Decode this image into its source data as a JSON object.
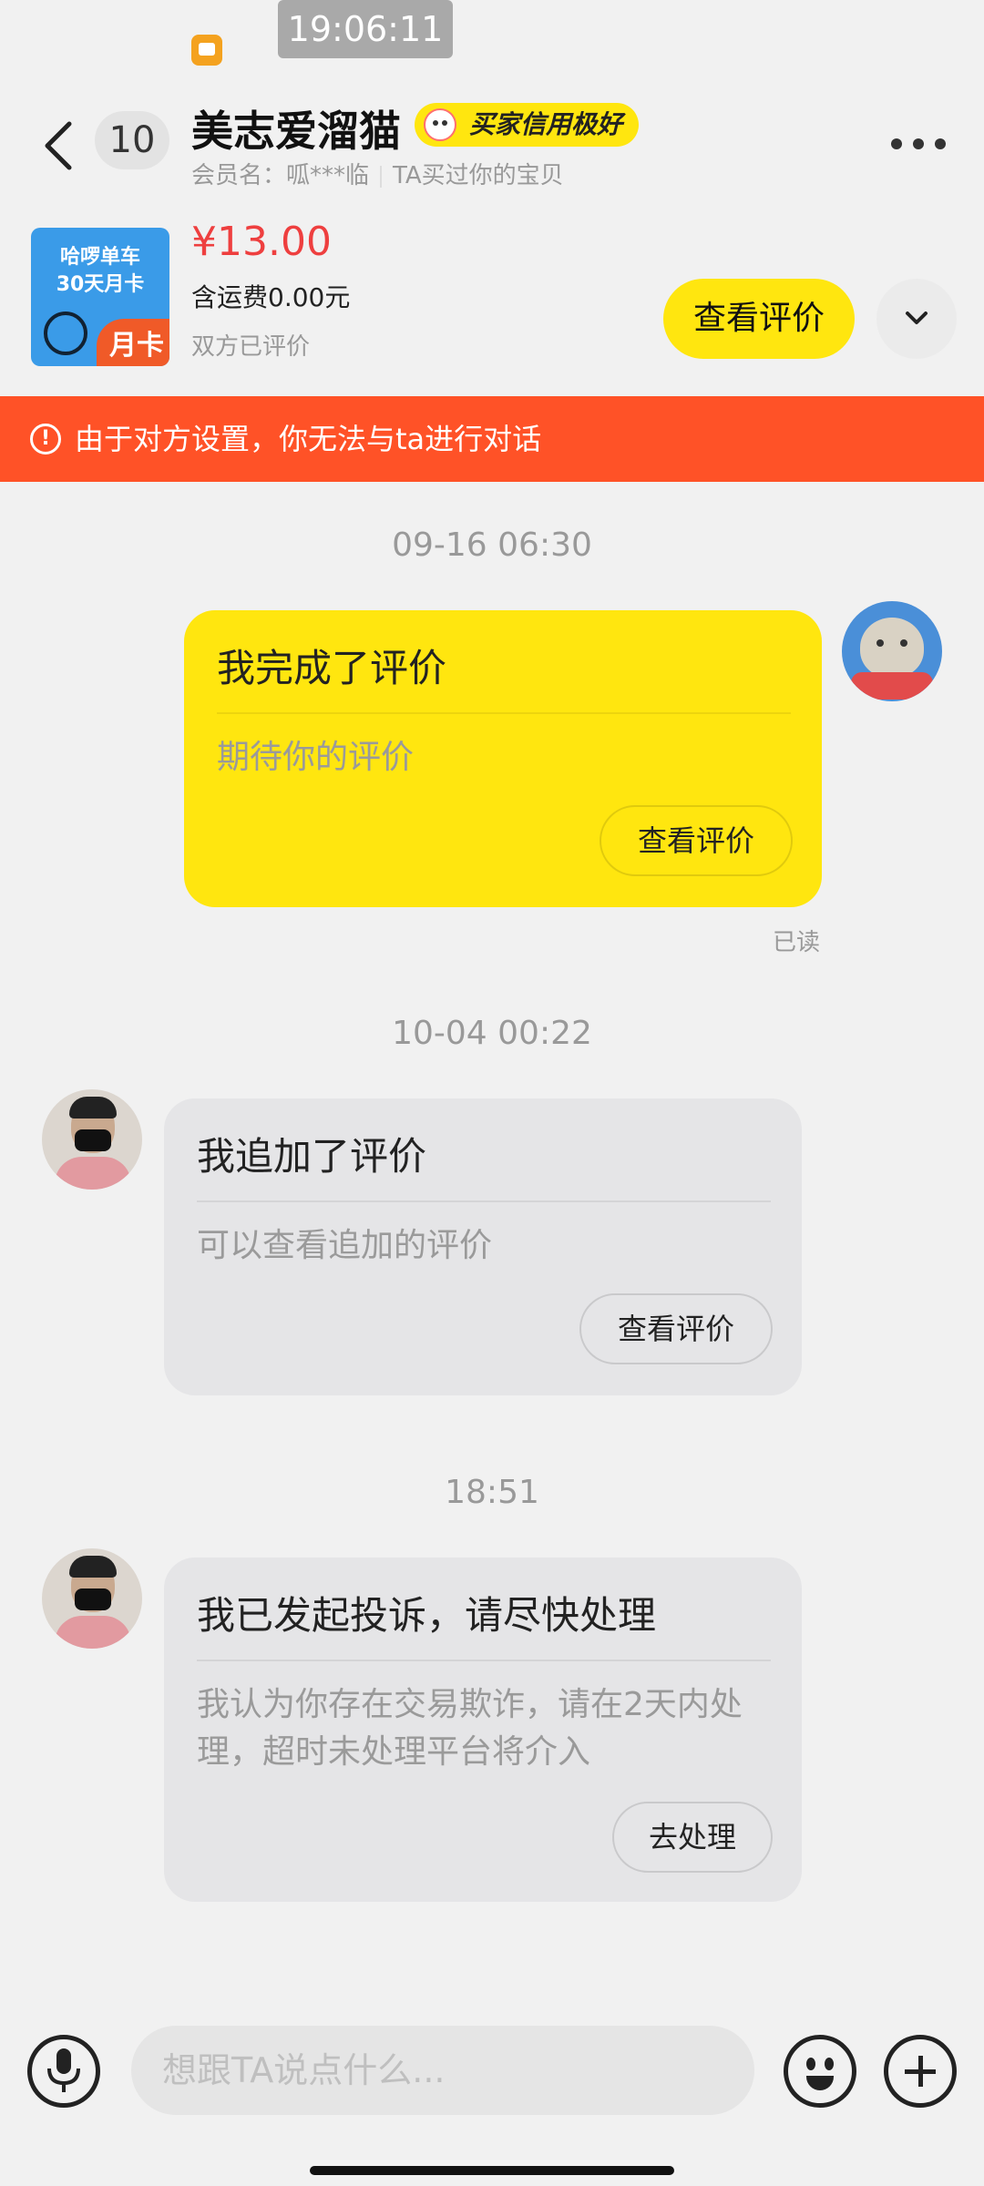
{
  "status_bar": {
    "time": "19:06:11"
  },
  "header": {
    "unread_count": "10",
    "contact_name": "美志爱溜猫",
    "credit_badge": "买家信用极好",
    "member_label": "会员名：呱***临",
    "purchase_note": "TA买过你的宝贝"
  },
  "product": {
    "thumb_title": "哈啰单车\n30天月卡",
    "thumb_card_label": "月卡",
    "price": "¥13.00",
    "shipping": "含运费0.00元",
    "evaluation_status": "双方已评价",
    "view_eval_label": "查看评价"
  },
  "warning": {
    "icon": "!",
    "text": "由于对方设置，你无法与ta进行对话"
  },
  "messages": [
    {
      "timestamp": "09-16 06:30",
      "title": "我完成了评价",
      "subtitle": "期待你的评价",
      "button": "查看评价",
      "read_status": "已读"
    },
    {
      "timestamp": "10-04 00:22",
      "title": "我追加了评价",
      "subtitle": "可以查看追加的评价",
      "button": "查看评价"
    },
    {
      "timestamp": "18:51",
      "title": "我已发起投诉，请尽快处理",
      "subtitle": "我认为你存在交易欺诈，请在2天内处理，超时未处理平台将介入",
      "button": "去处理"
    }
  ],
  "input": {
    "placeholder": "想跟TA说点什么..."
  },
  "colors": {
    "accent_yellow": "#ffe60f",
    "warning_orange": "#ff5227",
    "price_red": "#ee3f3f"
  },
  "icons": [
    "back-icon",
    "more-icon",
    "chevron-down-icon",
    "warning-icon",
    "microphone-icon",
    "emoji-icon",
    "plus-icon"
  ]
}
